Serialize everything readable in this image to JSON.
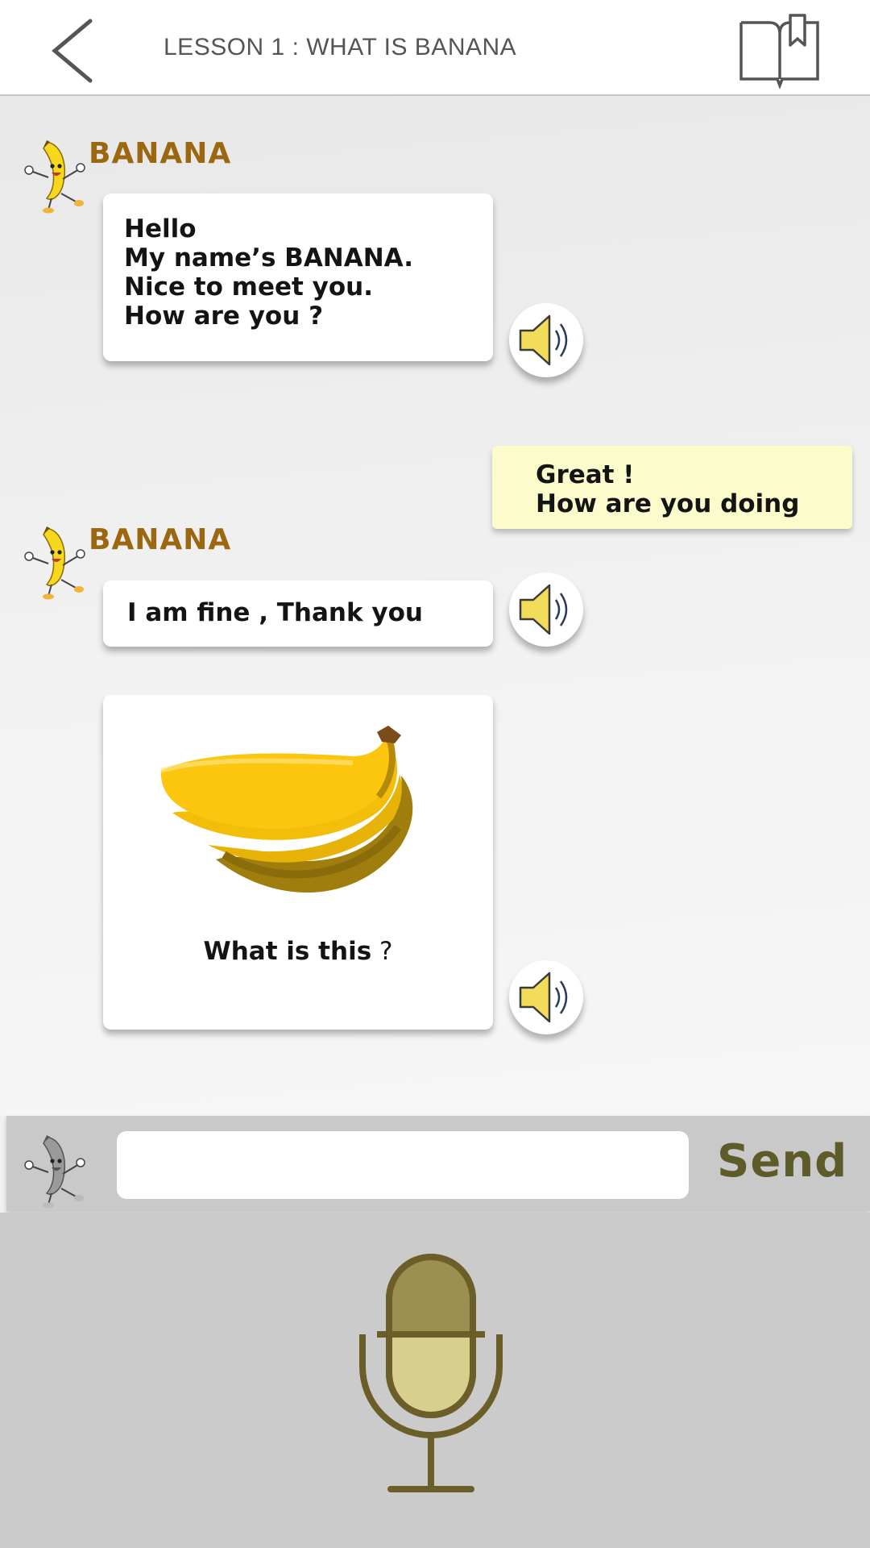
{
  "header": {
    "title": "LESSON 1 : WHAT IS BANANA",
    "back_icon": "chevron-left-icon",
    "book_icon": "bookmark-book-icon"
  },
  "chat": {
    "messages": [
      {
        "sender": "BANANA",
        "text": "Hello\nMy name’s BANANA.\nNice to meet you.\nHow are you ?"
      },
      {
        "sender": "user",
        "text": "Great !\nHow are you  doing"
      },
      {
        "sender": "BANANA",
        "text": "I am fine , Thank you"
      },
      {
        "sender": "BANANA",
        "caption_bold": "What is this",
        "caption_rest": " ?",
        "image": "banana-bunch"
      }
    ]
  },
  "input": {
    "value": "",
    "placeholder": "",
    "send_label": "Send"
  },
  "colors": {
    "speaker_name": "#9b6710",
    "user_bubble": "#fcfbcb",
    "send_text": "#5d5b2a",
    "mic": "#6b5e28"
  }
}
